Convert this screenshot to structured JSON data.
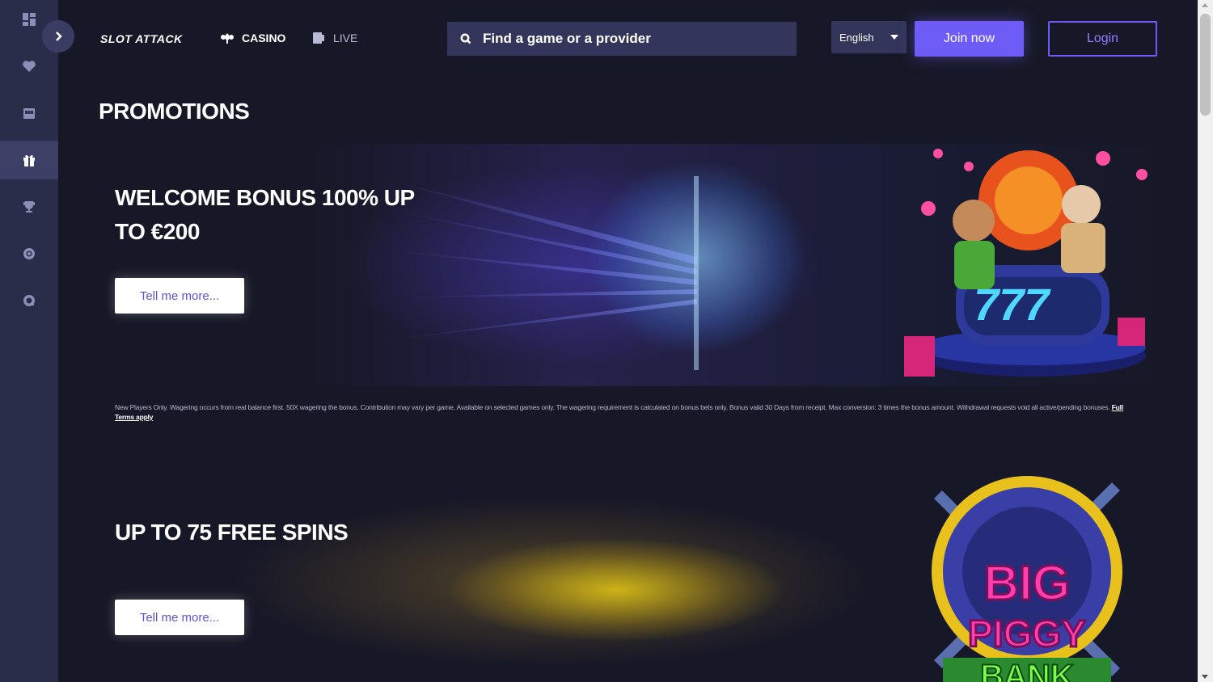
{
  "brand": {
    "logo_text": "SLOT ATTACK"
  },
  "nav": {
    "casino_label": "CASINO",
    "live_label": "LIVE"
  },
  "search": {
    "placeholder": "Find a game or a provider"
  },
  "language": {
    "selected": "English"
  },
  "auth": {
    "join_label": "Join now",
    "login_label": "Login"
  },
  "sidebar": {
    "items": [
      {
        "icon": "grid-icon"
      },
      {
        "icon": "heart-icon"
      },
      {
        "icon": "slot-machine-icon"
      },
      {
        "icon": "gift-icon",
        "active": true
      },
      {
        "icon": "trophy-icon"
      },
      {
        "icon": "chip-icon"
      },
      {
        "icon": "support-icon"
      }
    ]
  },
  "page": {
    "title": "PROMOTIONS"
  },
  "promotions": [
    {
      "title": "WELCOME BONUS 100% UP TO €200",
      "button_label": "Tell me more...",
      "terms": "New Players Only. Wagering occurs from real balance first. 50X wagering the bonus. Contribution may vary per game. Available on selected games only. The wagering requirement is calculated on bonus bets only. Bonus valid 30 Days from receipt. Max conversion: 3 times the bonus amount. Withdrawal requests void all active/pending bonuses.",
      "terms_link": "Full Terms apply"
    },
    {
      "title": "UP TO 75 FREE SPINS",
      "button_label": "Tell me more...",
      "art_text": "BIG PIGGY BANK"
    }
  ],
  "colors": {
    "accent": "#6d5cf5",
    "background": "#171827",
    "sidebar": "#2a2d4a"
  }
}
